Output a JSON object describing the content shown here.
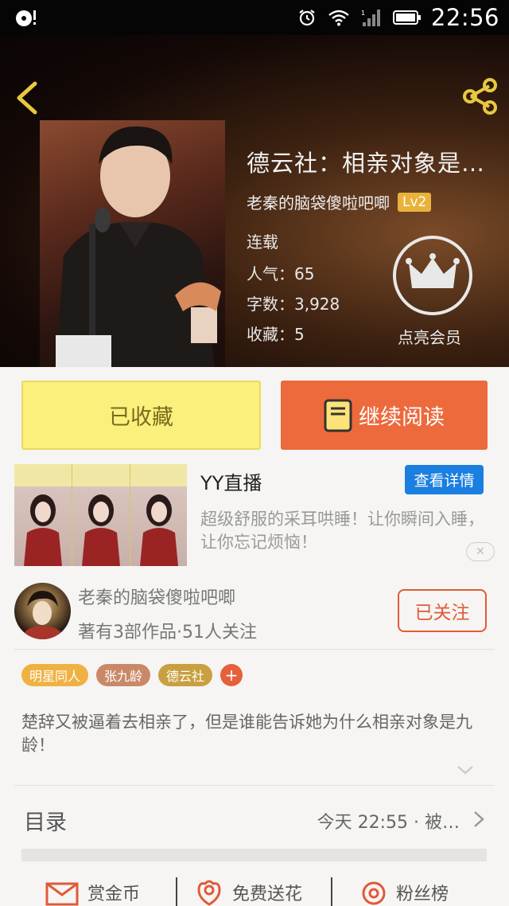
{
  "status_bar": {
    "time": "22:56",
    "icons": [
      "app-notification-icon",
      "alarm-icon",
      "wifi-icon",
      "signal-icon",
      "battery-icon"
    ]
  },
  "header": {
    "book_title": "德云社：相亲对象是…",
    "author": "老秦的脑袋傻啦吧唧",
    "level": "Lv2",
    "status": "连载",
    "popularity": "人气：65",
    "word_count": "字数：3,928",
    "favorites": "收藏：5",
    "vip_label": "点亮会员"
  },
  "actions": {
    "collected_label": "已收藏",
    "read_label": "继续阅读"
  },
  "ad": {
    "title": "YY直播",
    "detail_button": "查看详情",
    "description": "超级舒服的采耳哄睡！让你瞬间入睡，让你忘记烦恼！",
    "close_symbol": "✕"
  },
  "author_card": {
    "name": "老秦的脑袋傻啦吧唧",
    "meta": "著有3部作品·51人关注",
    "follow_label": "已关注"
  },
  "tags": [
    {
      "label": "明星同人",
      "color": "#efb242"
    },
    {
      "label": "张九龄",
      "color": "#c98968"
    },
    {
      "label": "德云社",
      "color": "#c8a040"
    }
  ],
  "tag_add": "+",
  "synopsis": "楚辞又被逼着去相亲了，但是谁能告诉她为什么相亲对象是九龄！",
  "toc": {
    "label": "目录",
    "latest": "今天  22:55 · 被…"
  },
  "bottom": {
    "reward": "赏金币",
    "flower": "免费送花",
    "fans": "粉丝榜"
  },
  "colors": {
    "accent_orange": "#ec6a3c",
    "collected_yellow": "#fbf07c",
    "ad_blue": "#1a7fe0",
    "follow_red": "#e05a3a"
  }
}
